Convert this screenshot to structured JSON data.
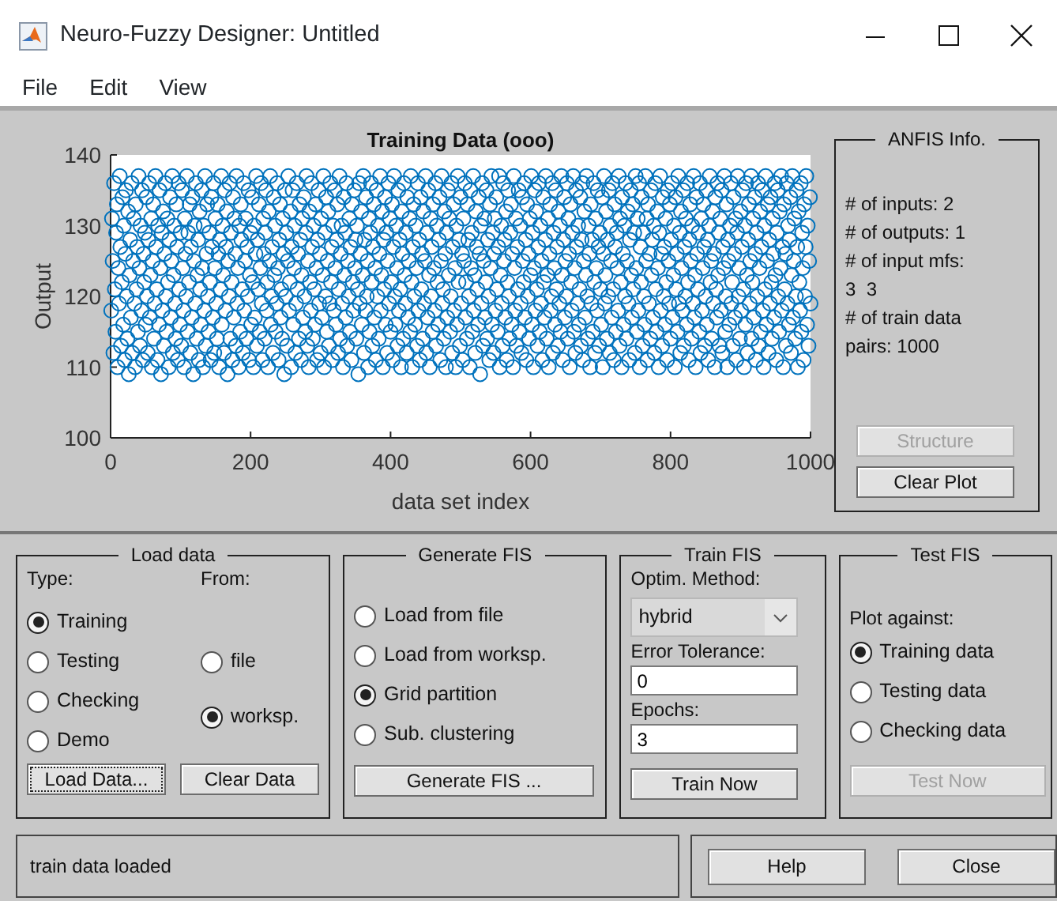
{
  "window": {
    "title": "Neuro-Fuzzy Designer: Untitled"
  },
  "menu": [
    "File",
    "Edit",
    "View"
  ],
  "plot": {
    "chart_data": {
      "type": "scatter",
      "title": "Training Data (ooo)",
      "xlabel": "data set index",
      "ylabel": "Output",
      "xlim": [
        0,
        1000
      ],
      "ylim": [
        100,
        140
      ],
      "xticks": [
        0,
        200,
        400,
        600,
        800,
        1000
      ],
      "yticks": [
        100,
        110,
        120,
        130,
        140
      ],
      "x": [
        1,
        2,
        3,
        4,
        5,
        6,
        7,
        8,
        9,
        10,
        11,
        12,
        13,
        14,
        15,
        16,
        17,
        18,
        19,
        20,
        21,
        22,
        23,
        24,
        25,
        26,
        27,
        28,
        29,
        30,
        31,
        32,
        33,
        34,
        35,
        36,
        37,
        38,
        39,
        40,
        41,
        42,
        43,
        44,
        45,
        46,
        47,
        48,
        49,
        50,
        51,
        52,
        53,
        54,
        55,
        56,
        57,
        58,
        59,
        60,
        61,
        62,
        63,
        64,
        65,
        66,
        67,
        68,
        69,
        70,
        71,
        72,
        73,
        74,
        75,
        76,
        77,
        78,
        79,
        80,
        81,
        82,
        83,
        84,
        85,
        86,
        87,
        88,
        89,
        90,
        91,
        92,
        93,
        94,
        95,
        96,
        97,
        98,
        99,
        100,
        101,
        102,
        103,
        104,
        105,
        106,
        107,
        108,
        109,
        110,
        111,
        112,
        113,
        114,
        115,
        116,
        117,
        118,
        119,
        120,
        121,
        122,
        123,
        124,
        125,
        126,
        127,
        128,
        129,
        130,
        131,
        132,
        133,
        134,
        135,
        136,
        137,
        138,
        139,
        140,
        141,
        142,
        143,
        144,
        145,
        146,
        147,
        148,
        149,
        150,
        151,
        152,
        153,
        154,
        155,
        156,
        157,
        158,
        159,
        160,
        161,
        162,
        163,
        164,
        165,
        166,
        167,
        168,
        169,
        170,
        171,
        172,
        173,
        174,
        175,
        176,
        177,
        178,
        179,
        180,
        181,
        182,
        183,
        184,
        185,
        186,
        187,
        188,
        189,
        190,
        191,
        192,
        193,
        194,
        195,
        196,
        197,
        198,
        199,
        200,
        201,
        202,
        203,
        204,
        205,
        206,
        207,
        208,
        209,
        210,
        211,
        212,
        213,
        214,
        215,
        216,
        217,
        218,
        219,
        220,
        221,
        222,
        223,
        224,
        225,
        226,
        227,
        228,
        229,
        230,
        231,
        232,
        233,
        234,
        235,
        236,
        237,
        238,
        239,
        240,
        241,
        242,
        243,
        244,
        245,
        246,
        247,
        248,
        249,
        250,
        251,
        252,
        253,
        254,
        255,
        256,
        257,
        258,
        259,
        260,
        261,
        262,
        263,
        264,
        265,
        266,
        267,
        268,
        269,
        270,
        271,
        272,
        273,
        274,
        275,
        276,
        277,
        278,
        279,
        280,
        281,
        282,
        283,
        284,
        285,
        286,
        287,
        288,
        289,
        290,
        291,
        292,
        293,
        294,
        295,
        296,
        297,
        298,
        299,
        300,
        301,
        302,
        303,
        304,
        305,
        306,
        307,
        308,
        309,
        310,
        311,
        312,
        313,
        314,
        315,
        316,
        317,
        318,
        319,
        320,
        321,
        322,
        323,
        324,
        325,
        326,
        327,
        328,
        329,
        330,
        331,
        332,
        333,
        334,
        335,
        336,
        337,
        338,
        339,
        340,
        341,
        342,
        343,
        344,
        345,
        346,
        347,
        348,
        349,
        350,
        351,
        352,
        353,
        354,
        355,
        356,
        357,
        358,
        359,
        360,
        361,
        362,
        363,
        364,
        365,
        366,
        367,
        368,
        369,
        370,
        371,
        372,
        373,
        374,
        375,
        376,
        377,
        378,
        379,
        380,
        381,
        382,
        383,
        384,
        385,
        386,
        387,
        388,
        389,
        390,
        391,
        392,
        393,
        394,
        395,
        396,
        397,
        398,
        399,
        400,
        401,
        402,
        403,
        404,
        405,
        406,
        407,
        408,
        409,
        410,
        411,
        412,
        413,
        414,
        415,
        416,
        417,
        418,
        419,
        420,
        421,
        422,
        423,
        424,
        425,
        426,
        427,
        428,
        429,
        430,
        431,
        432,
        433,
        434,
        435,
        436,
        437,
        438,
        439,
        440,
        441,
        442,
        443,
        444,
        445,
        446,
        447,
        448,
        449,
        450,
        451,
        452,
        453,
        454,
        455,
        456,
        457,
        458,
        459,
        460,
        461,
        462,
        463,
        464,
        465,
        466,
        467,
        468,
        469,
        470,
        471,
        472,
        473,
        474,
        475,
        476,
        477,
        478,
        479,
        480,
        481,
        482,
        483,
        484,
        485,
        486,
        487,
        488,
        489,
        490,
        491,
        492,
        493,
        494,
        495,
        496,
        497,
        498,
        499,
        500,
        501,
        502,
        503,
        504,
        505,
        506,
        507,
        508,
        509,
        510,
        511,
        512,
        513,
        514,
        515,
        516,
        517,
        518,
        519,
        520,
        521,
        522,
        523,
        524,
        525,
        526,
        527,
        528,
        529,
        530,
        531,
        532,
        533,
        534,
        535,
        536,
        537,
        538,
        539,
        540,
        541,
        542,
        543,
        544,
        545,
        546,
        547,
        548,
        549,
        550,
        551,
        552,
        553,
        554,
        555,
        556,
        557,
        558,
        559,
        560,
        561,
        562,
        563,
        564,
        565,
        566,
        567,
        568,
        569,
        570,
        571,
        572,
        573,
        574,
        575,
        576,
        577,
        578,
        579,
        580,
        581,
        582,
        583,
        584,
        585,
        586,
        587,
        588,
        589,
        590,
        591,
        592,
        593,
        594,
        595,
        596,
        597,
        598,
        599,
        600,
        601,
        602,
        603,
        604,
        605,
        606,
        607,
        608,
        609,
        610,
        611,
        612,
        613,
        614,
        615,
        616,
        617,
        618,
        619,
        620,
        621,
        622,
        623,
        624,
        625,
        626,
        627,
        628,
        629,
        630,
        631,
        632,
        633,
        634,
        635,
        636,
        637,
        638,
        639,
        640,
        641,
        642,
        643,
        644,
        645,
        646,
        647,
        648,
        649,
        650,
        651,
        652,
        653,
        654,
        655,
        656,
        657,
        658,
        659,
        660,
        661,
        662,
        663,
        664,
        665,
        666,
        667,
        668,
        669,
        670,
        671,
        672,
        673,
        674,
        675,
        676,
        677,
        678,
        679,
        680,
        681,
        682,
        683,
        684,
        685,
        686,
        687,
        688,
        689,
        690,
        691,
        692,
        693,
        694,
        695,
        696,
        697,
        698,
        699,
        700,
        701,
        702,
        703,
        704,
        705,
        706,
        707,
        708,
        709,
        710,
        711,
        712,
        713,
        714,
        715,
        716,
        717,
        718,
        719,
        720,
        721,
        722,
        723,
        724,
        725,
        726,
        727,
        728,
        729,
        730,
        731,
        732,
        733,
        734,
        735,
        736,
        737,
        738,
        739,
        740,
        741,
        742,
        743,
        744,
        745,
        746,
        747,
        748,
        749,
        750,
        751,
        752,
        753,
        754,
        755,
        756,
        757,
        758,
        759,
        760,
        761,
        762,
        763,
        764,
        765,
        766,
        767,
        768,
        769,
        770,
        771,
        772,
        773,
        774,
        775,
        776,
        777,
        778,
        779,
        780,
        781,
        782,
        783,
        784,
        785,
        786,
        787,
        788,
        789,
        790,
        791,
        792,
        793,
        794,
        795,
        796,
        797,
        798,
        799,
        800,
        801,
        802,
        803,
        804,
        805,
        806,
        807,
        808,
        809,
        810,
        811,
        812,
        813,
        814,
        815,
        816,
        817,
        818,
        819,
        820,
        821,
        822,
        823,
        824,
        825,
        826,
        827,
        828,
        829,
        830,
        831,
        832,
        833,
        834,
        835,
        836,
        837,
        838,
        839,
        840,
        841,
        842,
        843,
        844,
        845,
        846,
        847,
        848,
        849,
        850,
        851,
        852,
        853,
        854,
        855,
        856,
        857,
        858,
        859,
        860,
        861,
        862,
        863,
        864,
        865,
        866,
        867,
        868,
        869,
        870,
        871,
        872,
        873,
        874,
        875,
        876,
        877,
        878,
        879,
        880,
        881,
        882,
        883,
        884,
        885,
        886,
        887,
        888,
        889,
        890,
        891,
        892,
        893,
        894,
        895,
        896,
        897,
        898,
        899,
        900,
        901,
        902,
        903,
        904,
        905,
        906,
        907,
        908,
        909,
        910,
        911,
        912,
        913,
        914,
        915,
        916,
        917,
        918,
        919,
        920,
        921,
        922,
        923,
        924,
        925,
        926,
        927,
        928,
        929,
        930,
        931,
        932,
        933,
        934,
        935,
        936,
        937,
        938,
        939,
        940,
        941,
        942,
        943,
        944,
        945,
        946,
        947,
        948,
        949,
        950,
        951,
        952,
        953,
        954,
        955,
        956,
        957,
        958,
        959,
        960,
        961,
        962,
        963,
        964,
        965,
        966,
        967,
        968,
        969,
        970,
        971,
        972,
        973,
        974,
        975,
        976,
        977,
        978,
        979,
        980,
        981,
        982,
        983,
        984,
        985,
        986,
        987,
        988,
        989,
        990,
        991,
        992,
        993,
        994,
        995,
        996,
        997,
        998,
        999,
        1000
      ],
      "series": [
        {
          "color": "#0072bd",
          "values": [
            118,
            131,
            125,
            112,
            136,
            121,
            115,
            129,
            133,
            110,
            124,
            119,
            137,
            127,
            113,
            122,
            134,
            116,
            130,
            111,
            126,
            135,
            120,
            114,
            132,
            109,
            123,
            128,
            117,
            136,
            112,
            125,
            131,
            119,
            110,
            133,
            121,
            127,
            115,
            137,
            124,
            113,
            130,
            118,
            135,
            111,
            126,
            122,
            129,
            116,
            134,
            120,
            112,
            128,
            136,
            117,
            123,
            131,
            110,
            125,
            133,
            114,
            119,
            137,
            127,
            121,
            111,
            130,
            116,
            135,
            124,
            109,
            129,
            118,
            132,
            113,
            126,
            136,
            120,
            115,
            131,
            122,
            110,
            128,
            134,
            117,
            125,
            137,
            112,
            123,
            130,
            119,
            114,
            133,
            127,
            111,
            136,
            121,
            116,
            129,
            113,
            135,
            124,
            118,
            110,
            131,
            126,
            120,
            137,
            115,
            129,
            122,
            133,
            112,
            127,
            117,
            134,
            109,
            125,
            130,
            119,
            136,
            114,
            123,
            128,
            111,
            132,
            121,
            116,
            135,
            124,
            110,
            130,
            118,
            137,
            113,
            126,
            133,
            120,
            115,
            129,
            122,
            111,
            134,
            127,
            117,
            136,
            112,
            124,
            131,
            119,
            114,
            133,
            126,
            110,
            128,
            121,
            137,
            116,
            130,
            123,
            112,
            135,
            118,
            127,
            132,
            109,
            125,
            120,
            136,
            114,
            129,
            122,
            111,
            134,
            117,
            131,
            126,
            113,
            137,
            119,
            124,
            110,
            130,
            115,
            133,
            128,
            121,
            112,
            136,
            118,
            125,
            131,
            114,
            127,
            120,
            135,
            111,
            123,
            129,
            116,
            134,
            122,
            110,
            130,
            117,
            126,
            137,
            113,
            128,
            121,
            133,
            115,
            124,
            136,
            119,
            111,
            131,
            126,
            114,
            129,
            135,
            118,
            122,
            110,
            132,
            125,
            137,
            116,
            120,
            127,
            112,
            134,
            123,
            130,
            115,
            119,
            136,
            124,
            111,
            128,
            133,
            117,
            121,
            114,
            131,
            126,
            109,
            135,
            120,
            129,
            113,
            125,
            137,
            118,
            122,
            132,
            110,
            127,
            135,
            116,
            124,
            130,
            112,
            119,
            136,
            121,
            126,
            114,
            133,
            128,
            111,
            123,
            131,
            117,
            134,
            120,
            115,
            129,
            137,
            113,
            125,
            110,
            132,
            122,
            118,
            136,
            127,
            114,
            130,
            121,
            116,
            133,
            124,
            111,
            128,
            135,
            119,
            126,
            112,
            131,
            117,
            123,
            137,
            110,
            129,
            120,
            134,
            115,
            125,
            132,
            113,
            119,
            136,
            122,
            127,
            111,
            130,
            118,
            135,
            124,
            116,
            128,
            133,
            112,
            121,
            137,
            114,
            126,
            130,
            119,
            110,
            134,
            123,
            129,
            117,
            136,
            113,
            125,
            120,
            131,
            115,
            127,
            111,
            133,
            122,
            118,
            135,
            124,
            128,
            114,
            130,
            121,
            109,
            136,
            119,
            126,
            132,
            116,
            123,
            137,
            112,
            128,
            118,
            134,
            120,
            125,
            110,
            131,
            115,
            129,
            136,
            122,
            113,
            127,
            133,
            117,
            124,
            111,
            135,
            120,
            130,
            114,
            126,
            137,
            118,
            123,
            132,
            110,
            128,
            121,
            134,
            116,
            129,
            112,
            125,
            136,
            119,
            131,
            115,
            122,
            133,
            111,
            127,
            137,
            120,
            116,
            130,
            124,
            113,
            135,
            118,
            128,
            121,
            110,
            132,
            126,
            114,
            136,
            123,
            119,
            129,
            112,
            134,
            117,
            125,
            131,
            115,
            137,
            122,
            110,
            127,
            133,
            120,
            116,
            130,
            124,
            113,
            136,
            118,
            128,
            111,
            134,
            121,
            126,
            114,
            132,
            119,
            125,
            137,
            112,
            129,
            117,
            135,
            123,
            110,
            131,
            120,
            127,
            115,
            133,
            124,
            118,
            136,
            113,
            130,
            122,
            116,
            128,
            134,
            111,
            125,
            137,
            119,
            121,
            114,
            132,
            126,
            110,
            129,
            117,
            135,
            123,
            131,
            115,
            120,
            136,
            112,
            127,
            133,
            118,
            124,
            110,
            130,
            116,
            137,
            122,
            128,
            113,
            134,
            119,
            126,
            111,
            131,
            125,
            136,
            117,
            122,
            114,
            133,
            128,
            120,
            110,
            135,
            124,
            129,
            115,
            137,
            118,
            123,
            112,
            132,
            127,
            121,
            116,
            134,
            126,
            109,
            130,
            119,
            136,
            113,
            125,
            131,
            117,
            122,
            135,
            114,
            128,
            120,
            111,
            133,
            124,
            137,
            116,
            129,
            112,
            126,
            131,
            118,
            134,
            121,
            115,
            127,
            137,
            110,
            123,
            130,
            119,
            113,
            136,
            125,
            128,
            117,
            132,
            111,
            122,
            135,
            120,
            114,
            129,
            133,
            116,
            126,
            110,
            137,
            124,
            118,
            131,
            113,
            127,
            121,
            135,
            115,
            130,
            119,
            112,
            134,
            125,
            122,
            136,
            117,
            128,
            111,
            133,
            120,
            126,
            114,
            131,
            123,
            137,
            116,
            129,
            110,
            124,
            135,
            118,
            132,
            121,
            113,
            127,
            136,
            115,
            130,
            119,
            125,
            111,
            134,
            122,
            117,
            128,
            137,
            114,
            123,
            131,
            110,
            126,
            133,
            118,
            120,
            136,
            112,
            129,
            124,
            116,
            135,
            121,
            127,
            113,
            132,
            119,
            130,
            115,
            137,
            123,
            111,
            128,
            134,
            117,
            125,
            120,
            136,
            114,
            131,
            126,
            110,
            133,
            122,
            118,
            129,
            137,
            115,
            124,
            112,
            135,
            127,
            119,
            130,
            116,
            121,
            134,
            113,
            128,
            136,
            111,
            125,
            132,
            117,
            123,
            137,
            120,
            114,
            130,
            126,
            110,
            133,
            119,
            128,
            115,
            136,
            122,
            112,
            131,
            124,
            118,
            135,
            127,
            113,
            129,
            121,
            116,
            134,
            110,
            126,
            137,
            119,
            123,
            132,
            114,
            128,
            120,
            135,
            112,
            130,
            125,
            117,
            136,
            121,
            111,
            133,
            127,
            115,
            129,
            124,
            118,
            137,
            113,
            131,
            122,
            110,
            134,
            126,
            116,
            130,
            120,
            136,
            114,
            125,
            132,
            119,
            111,
            128,
            135,
            123,
            117,
            133,
            121,
            129,
            112,
            137,
            124,
            115,
            131,
            118,
            136,
            110,
            127,
            122,
            134,
            113,
            129,
            120,
            116,
            137,
            125,
            131,
            111,
            133,
            119,
            126,
            114,
            135,
            123,
            128,
            117,
            130,
            112,
            136,
            121,
            115,
            132,
            124,
            110,
            129,
            137,
            118,
            126,
            113,
            134,
            120,
            127,
            116,
            131,
            122,
            111,
            135,
            125,
            119,
            133,
            114,
            128,
            136,
            117,
            123,
            130,
            110,
            134,
            121,
            126,
            115,
            137,
            119,
            129,
            112,
            132,
            124,
            118,
            135,
            113,
            127,
            120,
            131,
            116,
            136,
            122,
            111,
            128,
            133,
            125,
            114,
            130,
            119,
            137,
            117,
            123,
            110,
            134,
            126,
            121,
            129,
            115,
            136,
            112,
            131,
            118,
            124,
            133,
            127,
            113,
            120,
            135,
            116,
            128,
            111,
            130,
            137,
            122,
            125,
            114,
            132,
            119,
            126,
            110,
            134,
            121,
            117,
            136,
            123,
            129,
            113,
            131,
            118,
            135,
            112,
            127,
            124,
            137,
            115,
            120,
            133,
            110,
            128,
            125,
            116,
            130,
            136,
            119,
            122,
            113,
            134,
            126,
            117,
            131,
            111,
            129,
            137,
            120,
            124,
            114,
            132,
            118,
            127,
            135,
            121,
            110,
            130,
            116,
            136,
            123,
            112,
            128,
            133,
            119,
            125,
            137,
            114,
            122,
            131,
            117,
            134,
            126,
            111,
            129,
            120,
            136,
            113,
            124,
            132,
            115,
            127,
            135,
            118,
            110,
            130,
            121,
            137,
            116,
            125,
            133,
            112,
            128,
            119,
            134,
            122,
            114,
            131,
            126,
            117,
            136,
            123,
            111,
            129,
            135,
            120,
            115,
            132,
            124,
            137,
            118,
            127,
            110,
            133,
            121,
            126,
            113,
            136,
            119,
            130,
            116,
            128,
            134,
            112,
            123,
            137,
            117,
            125,
            131,
            114,
            120,
            135,
            127,
            110,
            132,
            122,
            118,
            136,
            115,
            129,
            124,
            111,
            133,
            120,
            127,
            137,
            116,
            130,
            113,
            125,
            134,
            119
          ]
        }
      ]
    }
  },
  "anfis_info": {
    "title": "ANFIS Info.",
    "lines": [
      "# of inputs: 2",
      "# of outputs: 1",
      "# of input mfs:",
      "3  3",
      "# of train data",
      "pairs: 1000"
    ],
    "buttons": [
      {
        "label": "Structure",
        "disabled": true
      },
      {
        "label": "Clear Plot",
        "disabled": false
      }
    ]
  },
  "load_data": {
    "title": "Load data",
    "type_label": "Type:",
    "from_label": "From:",
    "types": [
      {
        "label": "Training",
        "selected": true
      },
      {
        "label": "Testing",
        "selected": false
      },
      {
        "label": "Checking",
        "selected": false
      },
      {
        "label": "Demo",
        "selected": false
      }
    ],
    "sources": [
      {
        "label": "file",
        "selected": false
      },
      {
        "label": "worksp.",
        "selected": true
      }
    ],
    "buttons": [
      {
        "label": "Load Data...",
        "focused": true
      },
      {
        "label": "Clear Data",
        "focused": false
      }
    ]
  },
  "generate_fis": {
    "title": "Generate FIS",
    "options": [
      {
        "label": "Load from file",
        "selected": false
      },
      {
        "label": "Load from worksp.",
        "selected": false
      },
      {
        "label": "Grid partition",
        "selected": true
      },
      {
        "label": "Sub. clustering",
        "selected": false
      }
    ],
    "button": "Generate FIS ..."
  },
  "train_fis": {
    "title": "Train FIS",
    "method_label": "Optim. Method:",
    "method": "hybrid",
    "tolerance_label": "Error Tolerance:",
    "tolerance": "0",
    "epochs_label": "Epochs:",
    "epochs": "3",
    "button": "Train Now"
  },
  "test_fis": {
    "title": "Test FIS",
    "plot_label": "Plot against:",
    "options": [
      {
        "label": "Training data",
        "selected": true
      },
      {
        "label": "Testing data",
        "selected": false
      },
      {
        "label": "Checking data",
        "selected": false
      }
    ],
    "button": {
      "label": "Test Now",
      "disabled": true
    }
  },
  "status": "train data loaded",
  "footer_buttons": [
    "Help",
    "Close"
  ]
}
